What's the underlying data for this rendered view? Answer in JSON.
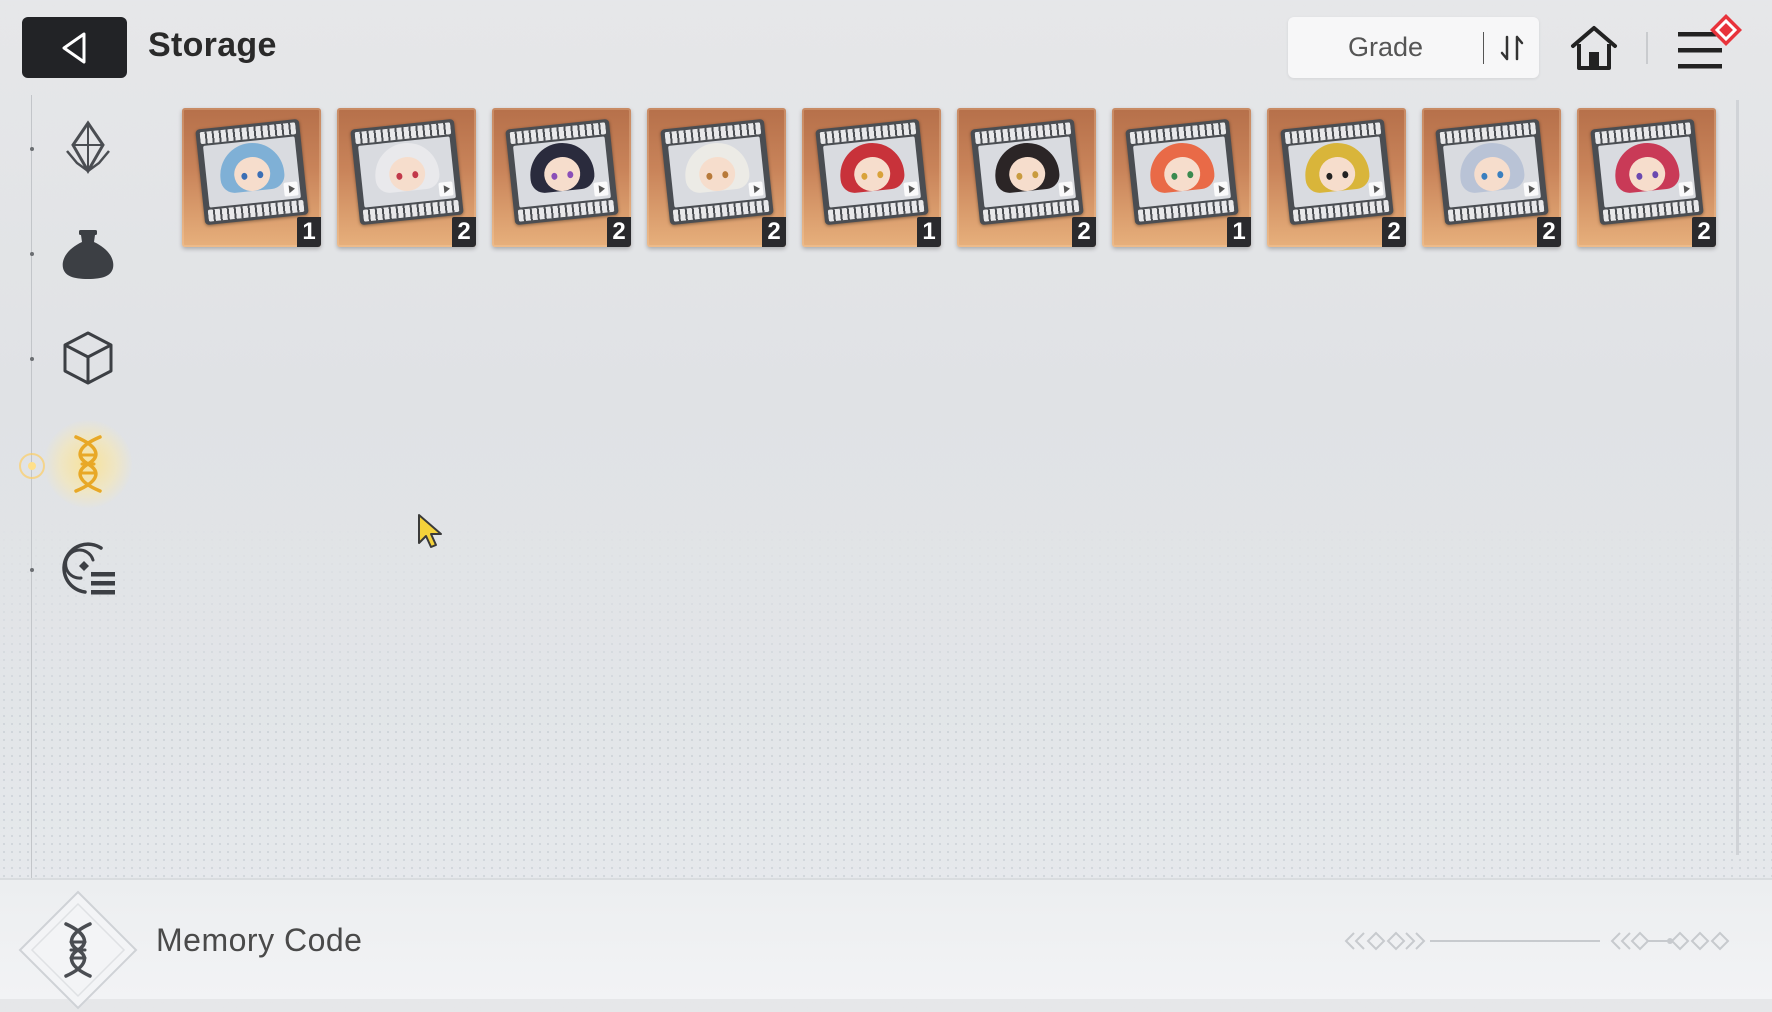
{
  "header": {
    "title": "Storage",
    "back_icon": "back-arrow-icon",
    "sort": {
      "label": "Grade",
      "toggle_icon": "sort-order-icon"
    },
    "home_icon": "home-icon",
    "menu_icon": "hamburger-menu-icon",
    "notification_color": "#e8333b"
  },
  "sidebar": {
    "items": [
      {
        "icon": "crystal-icon",
        "active": false
      },
      {
        "icon": "pouch-icon",
        "active": false
      },
      {
        "icon": "cube-icon",
        "active": false
      },
      {
        "icon": "dna-memory-icon",
        "active": true
      },
      {
        "icon": "record-list-icon",
        "active": false
      }
    ],
    "active_color": "#f2c14e"
  },
  "items": [
    {
      "count": "1",
      "hair_color": "#7fb0d6",
      "eye_color": "#3b6fb5"
    },
    {
      "count": "2",
      "hair_color": "#e9e9ec",
      "eye_color": "#c2394a"
    },
    {
      "count": "2",
      "hair_color": "#2a2b3d",
      "eye_color": "#8a4fb8"
    },
    {
      "count": "2",
      "hair_color": "#ecebe6",
      "eye_color": "#b87a3a"
    },
    {
      "count": "1",
      "hair_color": "#c8323a",
      "eye_color": "#d9a23a"
    },
    {
      "count": "2",
      "hair_color": "#2b2526",
      "eye_color": "#c99b3f"
    },
    {
      "count": "1",
      "hair_color": "#e96a47",
      "eye_color": "#3a8a4f"
    },
    {
      "count": "2",
      "hair_color": "#d9b53a",
      "eye_color": "#222222"
    },
    {
      "count": "2",
      "hair_color": "#b9c3d6",
      "eye_color": "#3a7fbf"
    },
    {
      "count": "2",
      "hair_color": "#c93a57",
      "eye_color": "#6a49b0"
    }
  ],
  "footer": {
    "title": "Memory Code",
    "emblem_icon": "dna-emblem-icon"
  },
  "colors": {
    "card_gradient_top": "#b6704a",
    "card_gradient_bottom": "#e7b07c",
    "cursor": "#f4d23a"
  }
}
